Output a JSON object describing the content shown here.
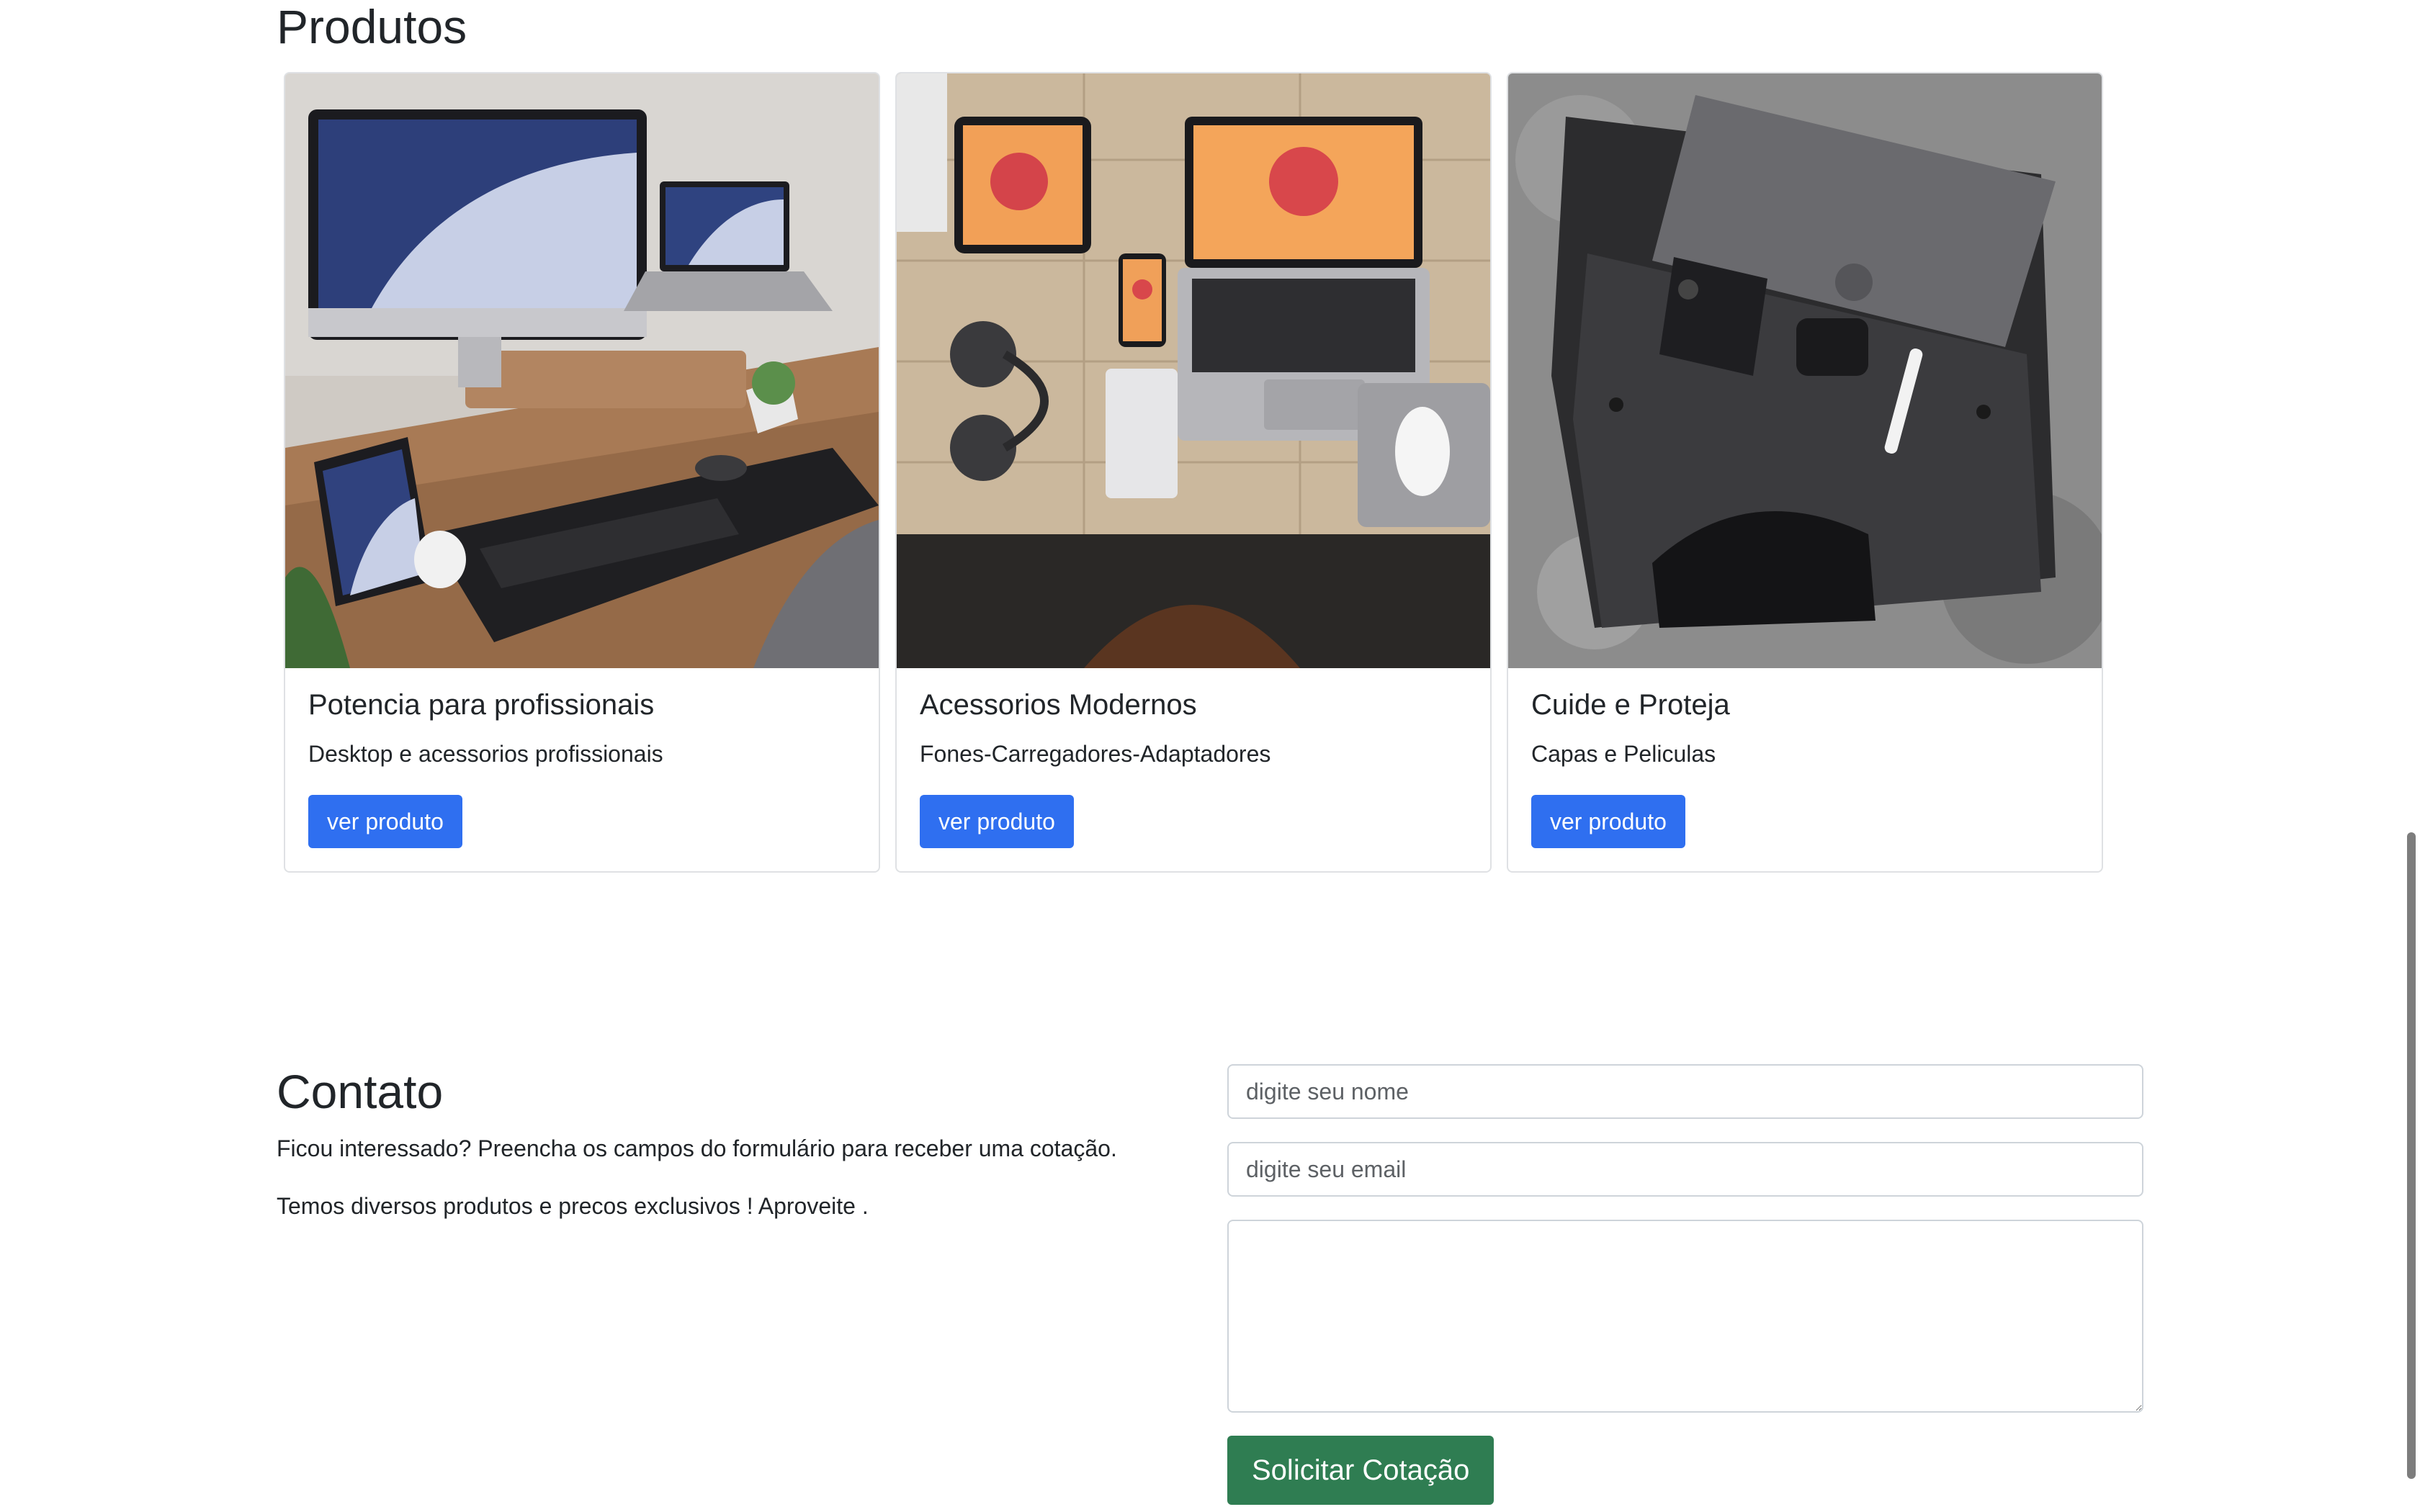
{
  "products": {
    "heading": "Produtos",
    "cards": [
      {
        "image_alt": "Workstation com iMac e MacBooks",
        "title": "Potencia para profissionais",
        "text": "Desktop e acessorios profissionais",
        "button_label": "ver produto"
      },
      {
        "image_alt": "Mesa com laptop, tablet, fones e acessórios",
        "title": "Acessorios Modernos",
        "text": "Fones-Carregadores-Adaptadores",
        "button_label": "ver produto"
      },
      {
        "image_alt": "Capa de feltro com laptop e iPhone",
        "title": "Cuide e Proteja",
        "text": "Capas e Peliculas",
        "button_label": "ver produto"
      }
    ]
  },
  "contact": {
    "heading": "Contato",
    "text_1": "Ficou interessado? Preencha os campos do formulário para receber uma cotação.",
    "text_2": "Temos diversos produtos e precos exclusivos ! Aproveite .",
    "form": {
      "name_placeholder": "digite seu nome",
      "name_value": "",
      "email_placeholder": "digite seu email",
      "email_value": "",
      "message_value": "",
      "submit_label": "Solicitar Cotação"
    }
  },
  "colors": {
    "primary_button": "#2f6ff0",
    "success_button": "#2f7d52",
    "text": "#212529"
  }
}
